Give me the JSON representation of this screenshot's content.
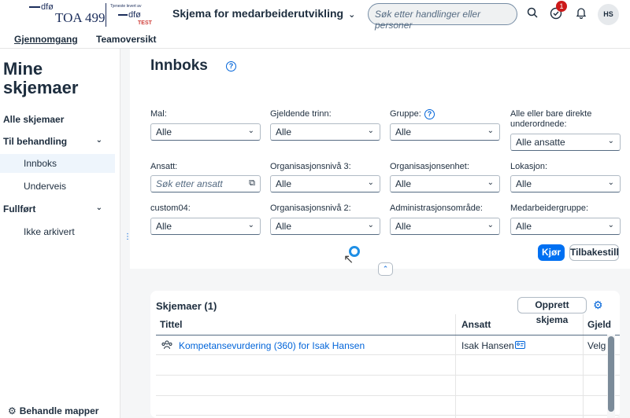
{
  "header": {
    "logo_dfo": "dfø",
    "logo_toa": "TOA 499",
    "logo_small": "Tjeneste levert av",
    "logo_dfo2": "dfø",
    "logo_test": "TEST",
    "app_title": "Skjema for medarbeiderutvikling",
    "search_placeholder": "Søk etter handlinger eller personer",
    "notification_count": "1",
    "avatar_initials": "HS"
  },
  "tabs": [
    {
      "label": "Gjennomgang"
    },
    {
      "label": "Teamoversikt"
    }
  ],
  "sidebar": {
    "title": "Mine skjemaer",
    "items": [
      {
        "label": "Alle skjemaer"
      },
      {
        "label": "Til behandling"
      },
      {
        "label": "Innboks"
      },
      {
        "label": "Underveis"
      },
      {
        "label": "Fullført"
      },
      {
        "label": "Ikke arkivert"
      }
    ],
    "bottom_label": "Behandle mapper"
  },
  "page": {
    "title": "Innboks"
  },
  "filters": {
    "mal": {
      "label": "Mal:",
      "value": "Alle"
    },
    "trinn": {
      "label": "Gjeldende trinn:",
      "value": "Alle"
    },
    "gruppe": {
      "label": "Gruppe:",
      "value": "Alle"
    },
    "underordnede": {
      "label": "Alle eller bare direkte underordnede:",
      "value": "Alle ansatte"
    },
    "ansatt": {
      "label": "Ansatt:",
      "placeholder": "Søk etter ansatt"
    },
    "org3": {
      "label": "Organisasjonsnivå 3:",
      "value": "Alle"
    },
    "orgenhet": {
      "label": "Organisasjonsenhet:",
      "value": "Alle"
    },
    "lokasjon": {
      "label": "Lokasjon:",
      "value": "Alle"
    },
    "custom04": {
      "label": "custom04:",
      "value": "Alle"
    },
    "org2": {
      "label": "Organisasjonsnivå 2:",
      "value": "Alle"
    },
    "adm": {
      "label": "Administrasjonsområde:",
      "value": "Alle"
    },
    "medgruppe": {
      "label": "Medarbeidergruppe:",
      "value": "Alle"
    },
    "run_label": "Kjør",
    "reset_label": "Tilbakestill"
  },
  "table": {
    "title": "Skjemaer (1)",
    "create_label": "Opprett skjema",
    "columns": [
      "Tittel",
      "Ansatt",
      "Gjeld"
    ],
    "rows": [
      {
        "title": "Kompetansevurdering (360) for Isak Hansen",
        "employee": "Isak Hansen",
        "step": "Velg"
      }
    ]
  }
}
